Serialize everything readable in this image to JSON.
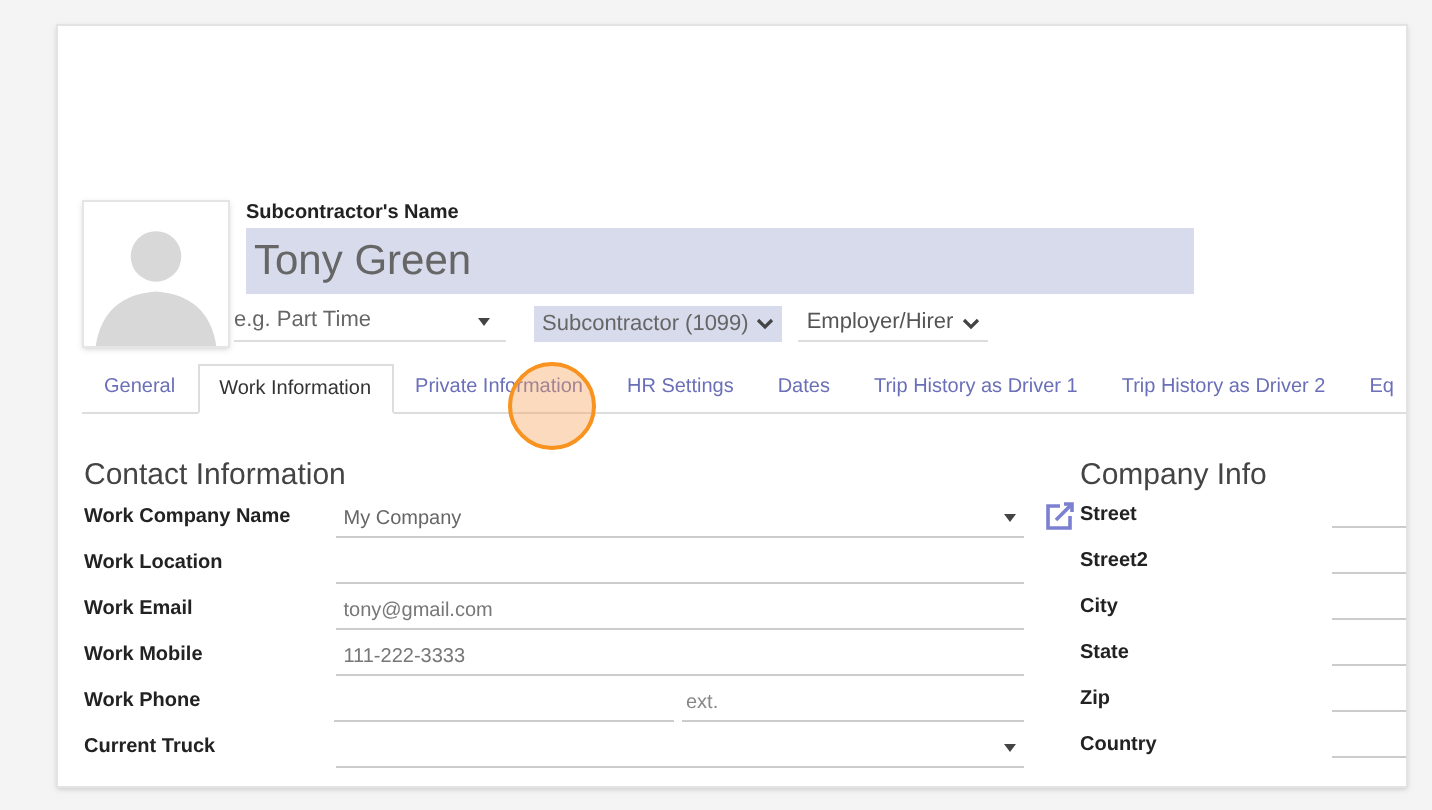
{
  "header": {
    "name_label": "Subcontractor's Name",
    "name": "Tony Green",
    "selects": [
      {
        "kind": "underline",
        "placeholder": "e.g. Part Time"
      },
      {
        "kind": "chip",
        "value": "Subcontractor (1099)"
      },
      {
        "kind": "plain",
        "value": "Employer/Hirer"
      }
    ]
  },
  "tabs": [
    {
      "label": "General",
      "selected": false
    },
    {
      "label": "Work Information",
      "selected": true
    },
    {
      "label": "Private Information",
      "selected": false
    },
    {
      "label": "HR Settings",
      "selected": false
    },
    {
      "label": "Dates",
      "selected": false
    },
    {
      "label": "Trip History as Driver 1",
      "selected": false
    },
    {
      "label": "Trip History as Driver 2",
      "selected": false
    },
    {
      "label": "Eq",
      "selected": false
    }
  ],
  "contact": {
    "title": "Contact Information",
    "fields": [
      {
        "label": "Work Company Name",
        "kind": "select",
        "value": "My Company"
      },
      {
        "label": "Work Location",
        "kind": "text"
      },
      {
        "label": "Work Email",
        "kind": "text",
        "value": "tony@gmail.com"
      },
      {
        "label": "Work Mobile",
        "kind": "text",
        "value": "111-222-3333"
      },
      {
        "label": "Work Phone",
        "kind": "phone",
        "placeholder": "ext."
      },
      {
        "label": "Current Truck",
        "kind": "select"
      }
    ]
  },
  "company": {
    "title": "Company Info",
    "fields": [
      "Street",
      "Street2",
      "City",
      "State",
      "Zip",
      "Country"
    ]
  }
}
